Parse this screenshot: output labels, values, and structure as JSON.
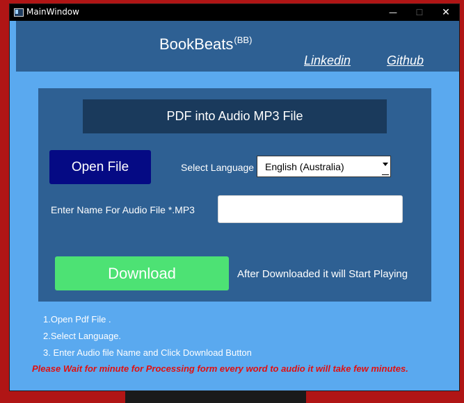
{
  "window": {
    "title": "MainWindow",
    "controls": {
      "minimize": "—",
      "maximize": "☐",
      "close": "✕"
    }
  },
  "header": {
    "brand": "BookBeats",
    "brand_sup": "(BB)",
    "links": {
      "linkedin": "Linkedin",
      "github": "Github"
    }
  },
  "panel": {
    "title": "PDF into Audio MP3 File",
    "open_button": "Open File",
    "language_label": "Select Language :",
    "language_selected": "English (Australia)",
    "name_label": "Enter Name For Audio File *.MP3",
    "name_value": "",
    "download_button": "Download",
    "after_text": "After Downloaded it will Start Playing"
  },
  "instructions": {
    "steps": [
      "1.Open Pdf File .",
      "2.Select Language.",
      "3. Enter Audio file Name and  Click  Download Button"
    ],
    "warning": "Please Wait for minute for Processing form every word to audio it will take few minutes."
  },
  "colors": {
    "window_bg": "#5aa9ef",
    "panel_bg": "#2e6093",
    "title_bg": "#1a3a5c",
    "open_button": "#050a84",
    "download_button": "#4de274",
    "warning": "#e11010"
  }
}
